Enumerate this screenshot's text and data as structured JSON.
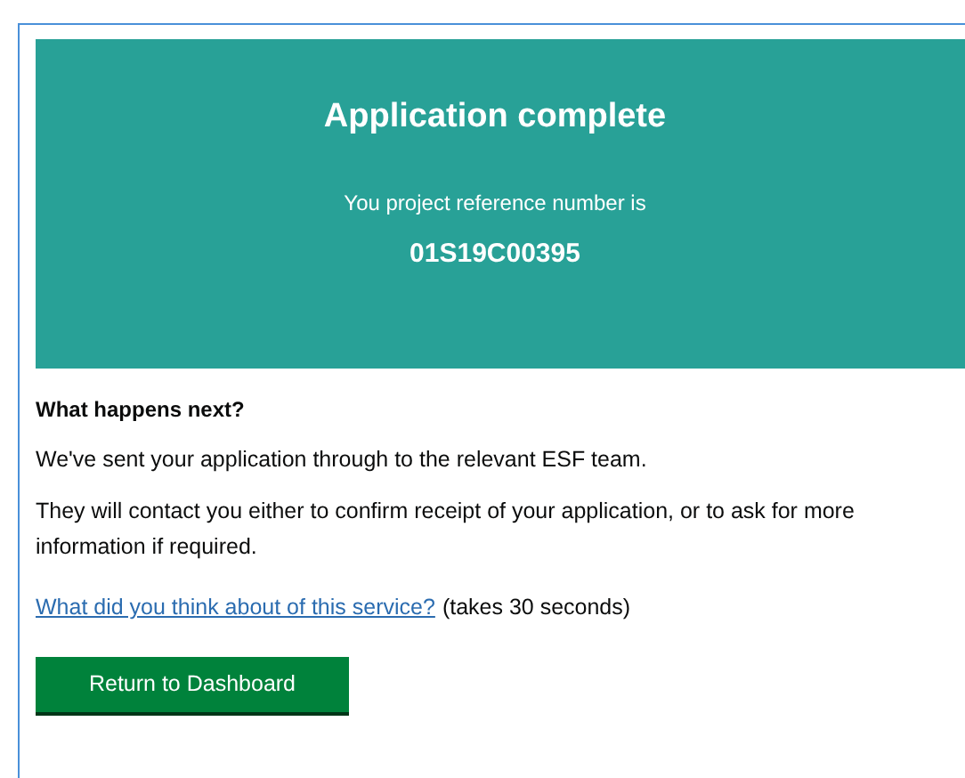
{
  "panel": {
    "title": "Application complete",
    "subtitle": "You project reference number is",
    "reference": "01S19C00395"
  },
  "next": {
    "heading": "What happens next?",
    "paragraphs": [
      "We've sent your application through to the relevant ESF team.",
      "They will contact you either to confirm receipt of your application, or to ask for more information if required."
    ],
    "feedback_link": "What did you think about of this service?",
    "feedback_note": "(takes 30 seconds)"
  },
  "button": "Return to Dashboard"
}
